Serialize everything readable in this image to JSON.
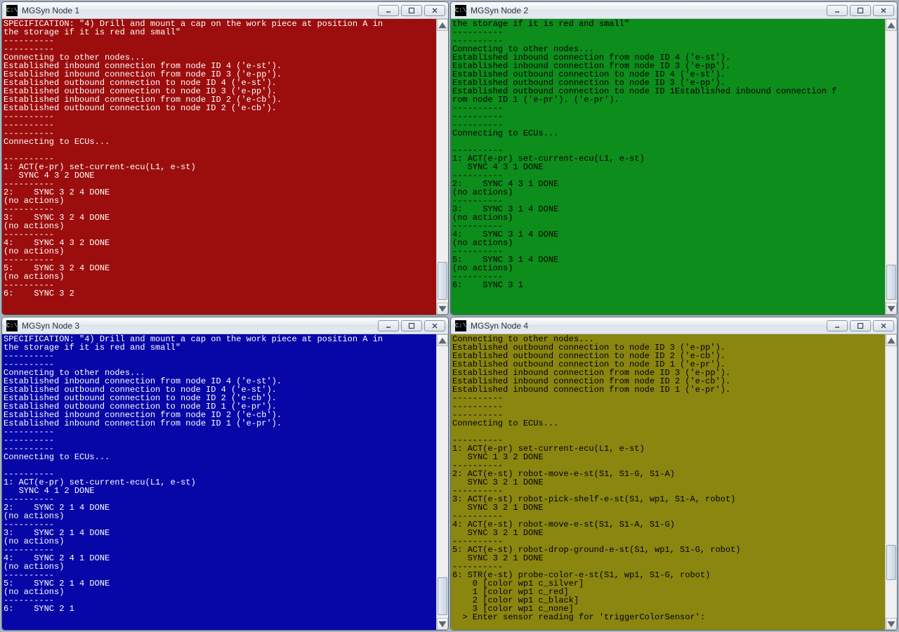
{
  "windows": [
    {
      "id": "node1",
      "title": "MGSyn Node 1",
      "console_class": "c1",
      "scroll_thumb": {
        "top_pct": 85,
        "height_pct": 14
      },
      "lines": [
        "SPECIFICATION: \"4) Drill and mount a cap on the work piece at position A in",
        "the storage if it is red and small\"",
        "----------",
        "----------",
        "Connecting to other nodes...",
        "Established inbound connection from node ID 4 ('e-st').",
        "Established inbound connection from node ID 3 ('e-pp').",
        "Established outbound connection to node ID 4 ('e-st').",
        "Established outbound connection to node ID 3 ('e-pp').",
        "Established inbound connection from node ID 2 ('e-cb').",
        "Established outbound connection to node ID 2 ('e-cb').",
        "----------",
        "----------",
        "----------",
        "Connecting to ECUs...",
        "",
        "----------",
        "1: ACT(e-pr) set-current-ecu(L1, e-st)",
        "   SYNC 4 3 2 DONE",
        "----------",
        "2:    SYNC 3 2 4 DONE",
        "(no actions)",
        "----------",
        "3:    SYNC 3 2 4 DONE",
        "(no actions)",
        "----------",
        "4:    SYNC 4 3 2 DONE",
        "(no actions)",
        "----------",
        "5:    SYNC 3 2 4 DONE",
        "(no actions)",
        "----------",
        "6:    SYNC 3 2"
      ]
    },
    {
      "id": "node2",
      "title": "MGSyn Node 2",
      "console_class": "c2",
      "scroll_thumb": {
        "top_pct": 86,
        "height_pct": 13
      },
      "lines": [
        "the storage if it is red and small\"",
        "----------",
        "----------",
        "Connecting to other nodes...",
        "Established inbound connection from node ID 4 ('e-st').",
        "Established inbound connection from node ID 3 ('e-pp').",
        "Established outbound connection to node ID 4 ('e-st').",
        "Established outbound connection to node ID 3 ('e-pp').",
        "Established outbound connection to node ID 1Established inbound connection f",
        "rom node ID 1 ('e-pr'). ('e-pr').",
        "----------",
        "----------",
        "----------",
        "Connecting to ECUs...",
        "",
        "----------",
        "1: ACT(e-pr) set-current-ecu(L1, e-st)",
        "   SYNC 4 3 1 DONE",
        "----------",
        "2:    SYNC 4 3 1 DONE",
        "(no actions)",
        "----------",
        "3:    SYNC 3 1 4 DONE",
        "(no actions)",
        "----------",
        "4:    SYNC 3 1 4 DONE",
        "(no actions)",
        "----------",
        "5:    SYNC 3 1 4 DONE",
        "(no actions)",
        "----------",
        "6:    SYNC 3 1"
      ]
    },
    {
      "id": "node3",
      "title": "MGSyn Node 3",
      "console_class": "c3",
      "scroll_thumb": {
        "top_pct": 85,
        "height_pct": 14
      },
      "lines": [
        "SPECIFICATION: \"4) Drill and mount a cap on the work piece at position A in",
        "the storage if it is red and small\"",
        "----------",
        "----------",
        "Connecting to other nodes...",
        "Established inbound connection from node ID 4 ('e-st').",
        "Established outbound connection to node ID 4 ('e-st').",
        "Established outbound connection to node ID 2 ('e-cb').",
        "Established outbound connection to node ID 1 ('e-pr').",
        "Established inbound connection from node ID 2 ('e-cb').",
        "Established inbound connection from node ID 1 ('e-pr').",
        "----------",
        "----------",
        "----------",
        "Connecting to ECUs...",
        "",
        "----------",
        "1: ACT(e-pr) set-current-ecu(L1, e-st)",
        "   SYNC 4 1 2 DONE",
        "----------",
        "2:    SYNC 2 1 4 DONE",
        "(no actions)",
        "----------",
        "3:    SYNC 2 1 4 DONE",
        "(no actions)",
        "----------",
        "4:    SYNC 2 4 1 DONE",
        "(no actions)",
        "----------",
        "5:    SYNC 2 1 4 DONE",
        "(no actions)",
        "----------",
        "6:    SYNC 2 1"
      ]
    },
    {
      "id": "node4",
      "title": "MGSyn Node 4",
      "console_class": "c4",
      "scroll_thumb": {
        "top_pct": 73,
        "height_pct": 13
      },
      "lines": [
        "Connecting to other nodes...",
        "Established outbound connection to node ID 3 ('e-pp').",
        "Established outbound connection to node ID 2 ('e-cb').",
        "Established outbound connection to node ID 1 ('e-pr').",
        "Established inbound connection from node ID 3 ('e-pp').",
        "Established inbound connection from node ID 2 ('e-cb').",
        "Established inbound connection from node ID 1 ('e-pr').",
        "----------",
        "----------",
        "----------",
        "Connecting to ECUs...",
        "",
        "----------",
        "1: ACT(e-pr) set-current-ecu(L1, e-st)",
        "   SYNC 1 3 2 DONE",
        "----------",
        "2: ACT(e-st) robot-move-e-st(S1, S1-G, S1-A)",
        "   SYNC 3 2 1 DONE",
        "----------",
        "3: ACT(e-st) robot-pick-shelf-e-st(S1, wp1, S1-A, robot)",
        "   SYNC 3 2 1 DONE",
        "----------",
        "4: ACT(e-st) robot-move-e-st(S1, S1-A, S1-G)",
        "   SYNC 3 2 1 DONE",
        "----------",
        "5: ACT(e-st) robot-drop-ground-e-st(S1, wp1, S1-G, robot)",
        "   SYNC 3 2 1 DONE",
        "----------",
        "6: STR(e-st) probe-color-e-st(S1, wp1, S1-G, robot)",
        "    0 [color wp1 c_silver]",
        "    1 [color wp1 c_red]",
        "    2 [color wp1 c_black]",
        "    3 [color wp1 c_none]",
        "  > Enter sensor reading for 'triggerColorSensor':"
      ]
    }
  ],
  "icon_label": "C:\\",
  "btn_labels": {
    "minimize": "minimize",
    "maximize": "maximize",
    "close": "close"
  }
}
